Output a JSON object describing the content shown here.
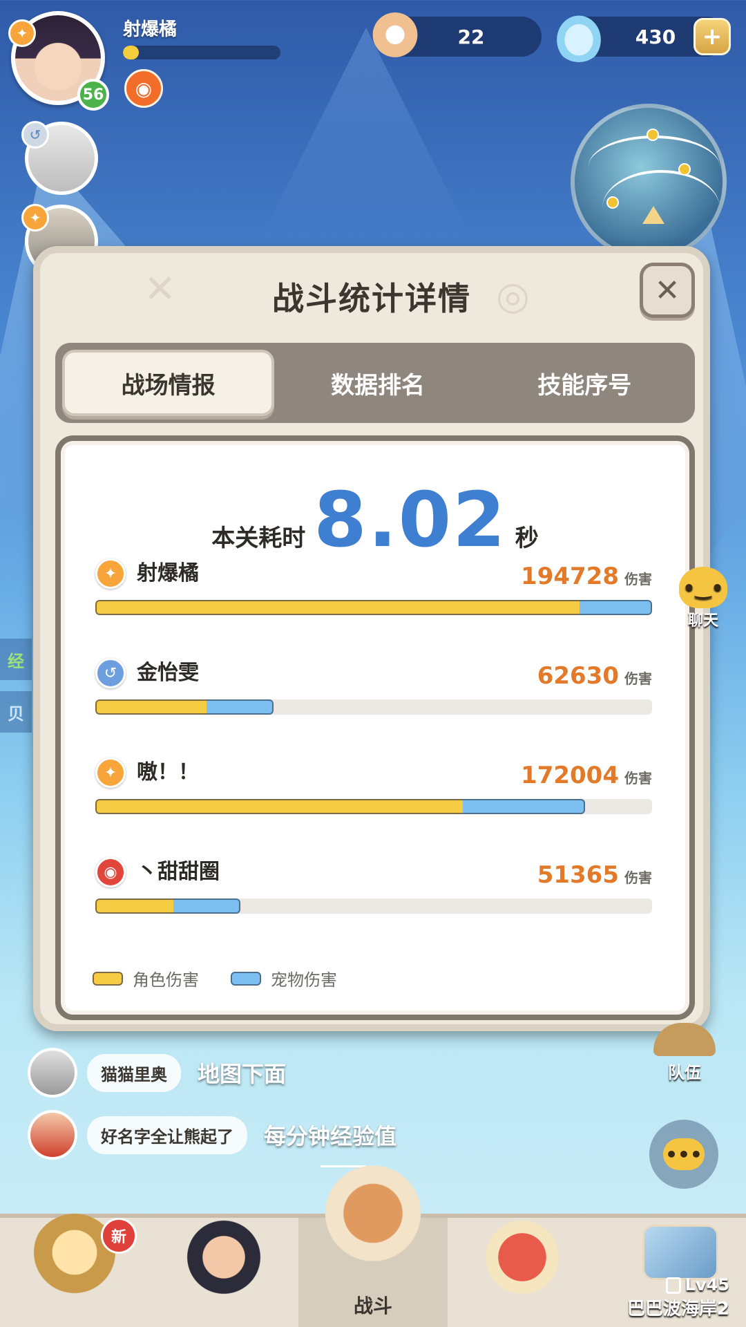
{
  "player": {
    "name": "射爆橘",
    "level": "56",
    "exp_fraction": 0.1
  },
  "currencies": {
    "pearl": "22",
    "shell": "430",
    "plus_icon": "plus-icon"
  },
  "modal": {
    "title": "战斗统计详情",
    "tabs": [
      "战场情报",
      "数据排名",
      "技能序号"
    ],
    "active_tab": 0,
    "time_label": "本关耗时",
    "time_value": "8.02",
    "time_unit": "秒",
    "damage_unit": "伤害",
    "legend": {
      "character": "角色伤害",
      "pet": "宠物伤害"
    },
    "players": [
      {
        "name": "射爆橘",
        "damage": "194728",
        "char_fraction": 0.87,
        "pet_fraction": 0.13,
        "total_fraction": 1.0,
        "icon_color": "#f7a53a"
      },
      {
        "name": "金怡雯",
        "damage": "62630",
        "char_fraction": 0.2,
        "pet_fraction": 0.12,
        "total_fraction": 0.32,
        "icon_color": "#6d9fe0"
      },
      {
        "name": "嗷！！",
        "damage": "172004",
        "char_fraction": 0.66,
        "pet_fraction": 0.22,
        "total_fraction": 0.88,
        "icon_color": "#f7a53a"
      },
      {
        "name": "丶甜甜圈",
        "damage": "51365",
        "char_fraction": 0.14,
        "pet_fraction": 0.12,
        "total_fraction": 0.26,
        "icon_color": "#e2453a"
      }
    ]
  },
  "colors": {
    "time_blue": "#3e7fd1",
    "damage_orange": "#e37a2a",
    "char_bar": "#f5cc44",
    "pet_bar": "#7cc0f2"
  },
  "side": {
    "chat_label": "聊天",
    "team_label": "队伍"
  },
  "chat": [
    {
      "user": "猫猫里奥",
      "text": "地图下面"
    },
    {
      "user": "好名字全让熊起了",
      "text": "每分钟经验值"
    }
  ],
  "bottom_nav": {
    "new_badge": "新",
    "battle_label": "战斗",
    "map_level": "Lv45",
    "map_name": "巴巴波海岸2"
  },
  "left_strip": [
    "经",
    "贝"
  ]
}
